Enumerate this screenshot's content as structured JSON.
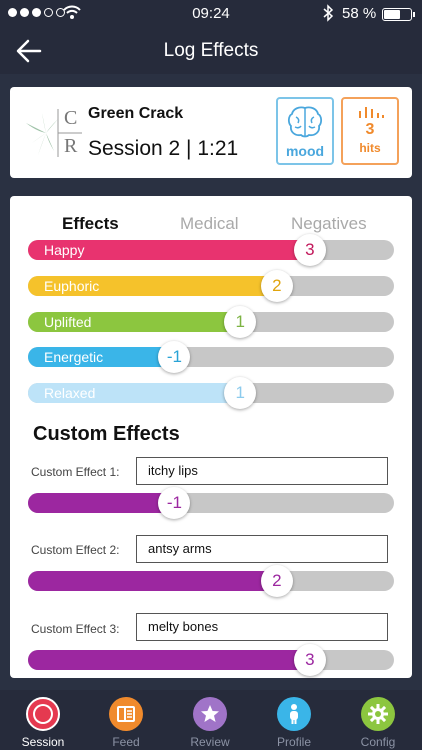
{
  "status_bar": {
    "time": "09:24",
    "battery": "58 %"
  },
  "header": {
    "title": "Log Effects"
  },
  "strain": {
    "name": "Green Crack",
    "session": "Session 2 | 1:21",
    "logo_letters": [
      "C",
      "R"
    ],
    "mood_label": "mood",
    "hits_count": "3",
    "hits_label": "hits"
  },
  "tabs": [
    {
      "label": "Effects",
      "active": true
    },
    {
      "label": "Medical",
      "active": false
    },
    {
      "label": "Negatives",
      "active": false
    }
  ],
  "effects": [
    {
      "label": "Happy",
      "value": "3",
      "level": 0.77,
      "color": "#e8336f",
      "text_color": "#c2185b"
    },
    {
      "label": "Euphoric",
      "value": "2",
      "level": 0.68,
      "color": "#f5c22b",
      "text_color": "#e0a40d"
    },
    {
      "label": "Uplifted",
      "value": "1",
      "level": 0.58,
      "color": "#8cc63f",
      "text_color": "#7cb342"
    },
    {
      "label": "Energetic",
      "value": "-1",
      "level": 0.4,
      "color": "#3ab5e8",
      "text_color": "#29a3d6"
    },
    {
      "label": "Relaxed",
      "value": "1",
      "level": 0.58,
      "color": "#bde3f8",
      "text_color": "#8ccbed"
    }
  ],
  "custom": {
    "title": "Custom Effects",
    "items": [
      {
        "label": "Custom Effect 1:",
        "text": "itchy lips",
        "value": "-1",
        "level": 0.4
      },
      {
        "label": "Custom Effect 2:",
        "text": "antsy arms",
        "value": "2",
        "level": 0.68
      },
      {
        "label": "Custom Effect 3:",
        "text": "melty bones",
        "value": "3",
        "level": 0.77
      }
    ],
    "color": "#9c27a0"
  },
  "nav": [
    {
      "label": "Session",
      "icon": "record-icon",
      "color": "#e53950",
      "active": true
    },
    {
      "label": "Feed",
      "icon": "feed-icon",
      "color": "#f08a2c",
      "active": false
    },
    {
      "label": "Review",
      "icon": "star-icon",
      "color": "#a074c8",
      "active": false
    },
    {
      "label": "Profile",
      "icon": "person-icon",
      "color": "#3ab5e8",
      "active": false
    },
    {
      "label": "Config",
      "icon": "gear-icon",
      "color": "#8cc63f",
      "active": false
    }
  ]
}
